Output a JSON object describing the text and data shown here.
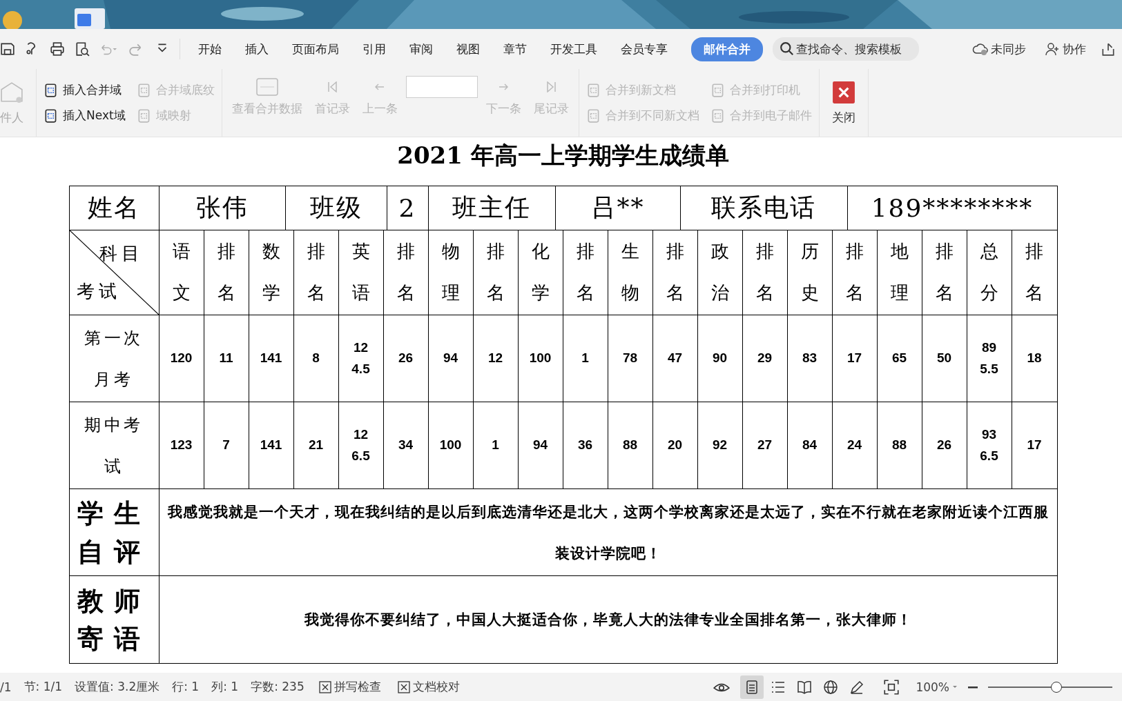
{
  "tabs": [
    {
      "label": "开始",
      "selected": false
    },
    {
      "label": "插入",
      "selected": false
    },
    {
      "label": "页面布局",
      "selected": false
    },
    {
      "label": "引用",
      "selected": false
    },
    {
      "label": "审阅",
      "selected": false
    },
    {
      "label": "视图",
      "selected": false
    },
    {
      "label": "章节",
      "selected": false
    },
    {
      "label": "开发工具",
      "selected": false
    },
    {
      "label": "会员专享",
      "selected": false
    },
    {
      "label": "邮件合并",
      "selected": true
    }
  ],
  "search": {
    "placeholder": "查找命令、搜索模板"
  },
  "top_right": [
    {
      "kind": "cloud",
      "label": "未同步"
    },
    {
      "kind": "person",
      "label": "协作"
    }
  ],
  "ribbon": [
    {
      "kind": "large",
      "items": [
        {
          "kind": "recipient",
          "label": "件人",
          "disabled": true
        }
      ]
    },
    {
      "kind": "grid",
      "items": [
        {
          "label": "插入合并域",
          "disabled": false
        },
        {
          "label": "合并域底纹",
          "disabled": true
        },
        {
          "label": "插入Next域",
          "disabled": false
        },
        {
          "label": "域映射",
          "disabled": true
        }
      ]
    },
    {
      "kind": "nav",
      "items": [
        {
          "kind": "button",
          "label": "查看合并数据",
          "disabled": true
        },
        {
          "kind": "button",
          "label": "首记录",
          "disabled": true
        },
        {
          "kind": "button",
          "label": "上一条",
          "disabled": true
        },
        {
          "kind": "field"
        },
        {
          "kind": "button",
          "label": "下一条",
          "disabled": true
        },
        {
          "kind": "button",
          "label": "尾记录",
          "disabled": true
        }
      ]
    },
    {
      "kind": "grid",
      "items": [
        {
          "label": "合并到新文档",
          "disabled": true
        },
        {
          "label": "合并到打印机",
          "disabled": true
        },
        {
          "label": "合并到不同新文档",
          "disabled": true
        },
        {
          "label": "合并到电子邮件",
          "disabled": true
        }
      ]
    },
    {
      "kind": "large",
      "items": [
        {
          "kind": "close",
          "label": "关闭",
          "disabled": false
        }
      ]
    }
  ],
  "document": {
    "title": "2021 年高一上学期学生成绩单",
    "info": [
      "姓名",
      "张伟",
      "班级",
      "2",
      "班主任",
      "吕**",
      "联系电话",
      "189********"
    ],
    "corner": {
      "top": "科目",
      "bottom": "考试"
    },
    "subjects": [
      "语文",
      "排名",
      "数学",
      "排名",
      "英语",
      "排名",
      "物理",
      "排名",
      "化学",
      "排名",
      "生物",
      "排名",
      "政治",
      "排名",
      "历史",
      "排名",
      "地理",
      "排名",
      "总分",
      "排名"
    ],
    "exams": [
      {
        "name": "第一次月考",
        "scores": [
          "120",
          "11",
          "141",
          "8",
          "124.5",
          "26",
          "94",
          "12",
          "100",
          "1",
          "78",
          "47",
          "90",
          "29",
          "83",
          "17",
          "65",
          "50",
          "895.5",
          "18"
        ]
      },
      {
        "name": "期中考试",
        "scores": [
          "123",
          "7",
          "141",
          "21",
          "126.5",
          "34",
          "100",
          "1",
          "94",
          "36",
          "88",
          "20",
          "92",
          "27",
          "84",
          "24",
          "88",
          "26",
          "936.5",
          "17"
        ]
      }
    ],
    "remarks": [
      {
        "label": "学生自评",
        "text": "我感觉我就是一个天才，现在我纠结的是以后到底选清华还是北大，这两个学校离家还是太远了，实在不行就在老家附近读个江西服装设计学院吧！"
      },
      {
        "label": "教师寄语",
        "text": "我觉得你不要纠结了，中国人大挺适合你，毕竟人大的法律专业全国排名第一，张大律师！"
      }
    ]
  },
  "status": {
    "items": [
      "/1",
      "节: 1/1",
      "设置值: 3.2厘米",
      "行: 1",
      "列: 1",
      "字数: 235"
    ],
    "tools": [
      "拼写检查",
      "文档校对"
    ],
    "views": [
      {
        "selected": true
      },
      {
        "selected": false
      },
      {
        "selected": false
      },
      {
        "selected": false
      },
      {
        "selected": false
      }
    ],
    "zoom": "100%",
    "zoom_slider": {
      "level": 0.55
    }
  }
}
